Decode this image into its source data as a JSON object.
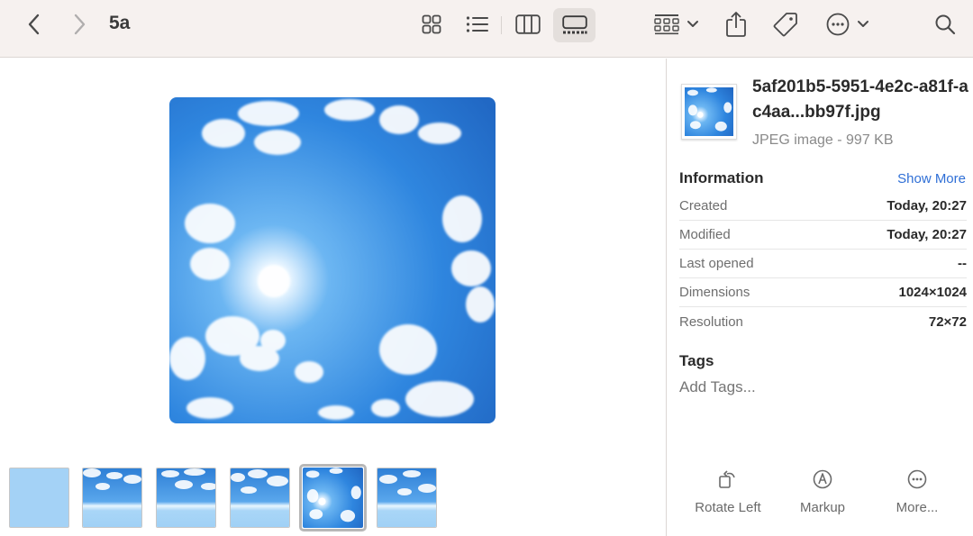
{
  "toolbar": {
    "folder_title": "5a",
    "icons": [
      "chevron-left-icon",
      "chevron-right-icon",
      "grid-view-icon",
      "list-view-icon",
      "column-view-icon",
      "gallery-view-icon",
      "group-icon",
      "share-icon",
      "tag-icon",
      "more-icon",
      "search-icon"
    ],
    "selected_view": "gallery"
  },
  "gallery": {
    "thumbnail_count": 6,
    "selected_thumbnail": 5
  },
  "inspector": {
    "file_name": "5af201b5-5951-4e2c-a81f-ac4aa...bb97f.jpg",
    "file_kind": "JPEG image - 997 KB",
    "info_title": "Information",
    "show_more": "Show More",
    "rows": [
      {
        "key": "Created",
        "value": "Today, 20:27"
      },
      {
        "key": "Modified",
        "value": "Today, 20:27"
      },
      {
        "key": "Last opened",
        "value": "--"
      },
      {
        "key": "Dimensions",
        "value": "1024×1024"
      },
      {
        "key": "Resolution",
        "value": "72×72"
      }
    ],
    "tags_title": "Tags",
    "tags_placeholder": "Add Tags...",
    "actions": [
      {
        "label": "Rotate Left",
        "icon": "rotate-left-icon"
      },
      {
        "label": "Markup",
        "icon": "markup-icon"
      },
      {
        "label": "More...",
        "icon": "more-icon"
      }
    ]
  },
  "colors": {
    "accent": "#2f6fd6",
    "toolbar_bg": "#f6f1ef",
    "sky": "#3a8be0"
  }
}
